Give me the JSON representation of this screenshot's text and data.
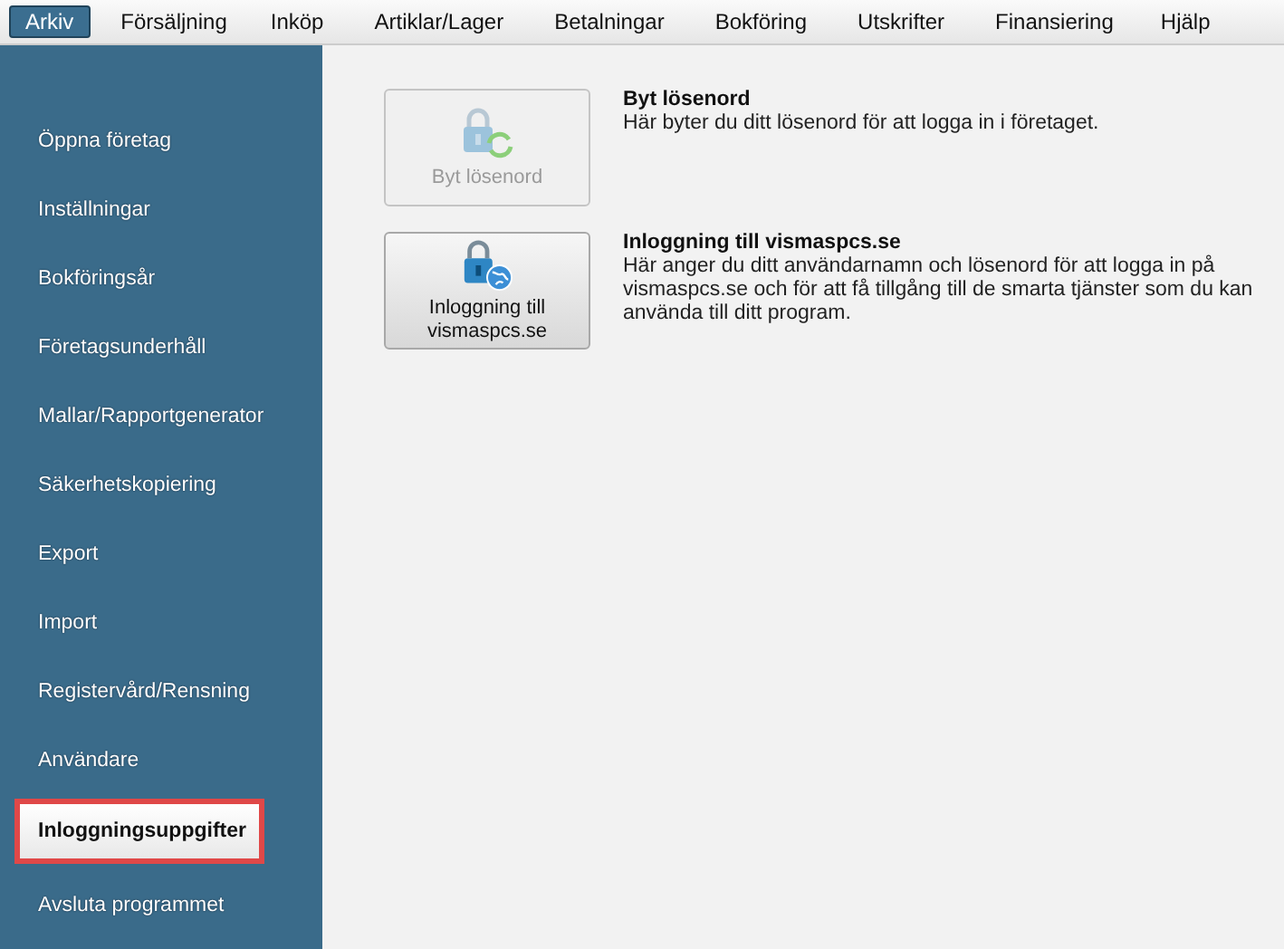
{
  "menu_bar": [
    {
      "label": "Arkiv",
      "selected": true
    },
    {
      "label": "Försäljning",
      "selected": false
    },
    {
      "label": "Inköp",
      "selected": false
    },
    {
      "label": "Artiklar/Lager",
      "selected": false
    },
    {
      "label": "Betalningar",
      "selected": false
    },
    {
      "label": "Bokföring",
      "selected": false
    },
    {
      "label": "Utskrifter",
      "selected": false
    },
    {
      "label": "Finansiering",
      "selected": false
    },
    {
      "label": "Hjälp",
      "selected": false
    }
  ],
  "sidebar": {
    "items": [
      {
        "label": "Öppna företag",
        "selected": false,
        "highlighted": false
      },
      {
        "label": "Inställningar",
        "selected": false,
        "highlighted": false
      },
      {
        "label": "Bokföringsår",
        "selected": false,
        "highlighted": false
      },
      {
        "label": "Företagsunderhåll",
        "selected": false,
        "highlighted": false
      },
      {
        "label": "Mallar/Rapportgenerator",
        "selected": false,
        "highlighted": false
      },
      {
        "label": "Säkerhetskopiering",
        "selected": false,
        "highlighted": false
      },
      {
        "label": "Export",
        "selected": false,
        "highlighted": false
      },
      {
        "label": "Import",
        "selected": false,
        "highlighted": false
      },
      {
        "label": "Registervård/Rensning",
        "selected": false,
        "highlighted": false
      },
      {
        "label": "Användare",
        "selected": false,
        "highlighted": false
      },
      {
        "label": "Inloggningsuppgifter",
        "selected": true,
        "highlighted": true
      },
      {
        "label": "Avsluta programmet",
        "selected": false,
        "highlighted": false
      }
    ]
  },
  "actions": [
    {
      "kind": "refresh",
      "button": "Byt lösenord",
      "disabled": true,
      "title": "Byt lösenord",
      "description": "Här byter du ditt lösenord för att logga in i företaget."
    },
    {
      "kind": "globe",
      "button": "Inloggning till vismaspcs.se",
      "disabled": false,
      "title": "Inloggning till vismaspcs.se",
      "description": "Här anger du ditt användarnamn och lösenord för att logga in på vismaspcs.se och för att få tillgång till de smarta tjänster som du kan använda till ditt program."
    }
  ]
}
